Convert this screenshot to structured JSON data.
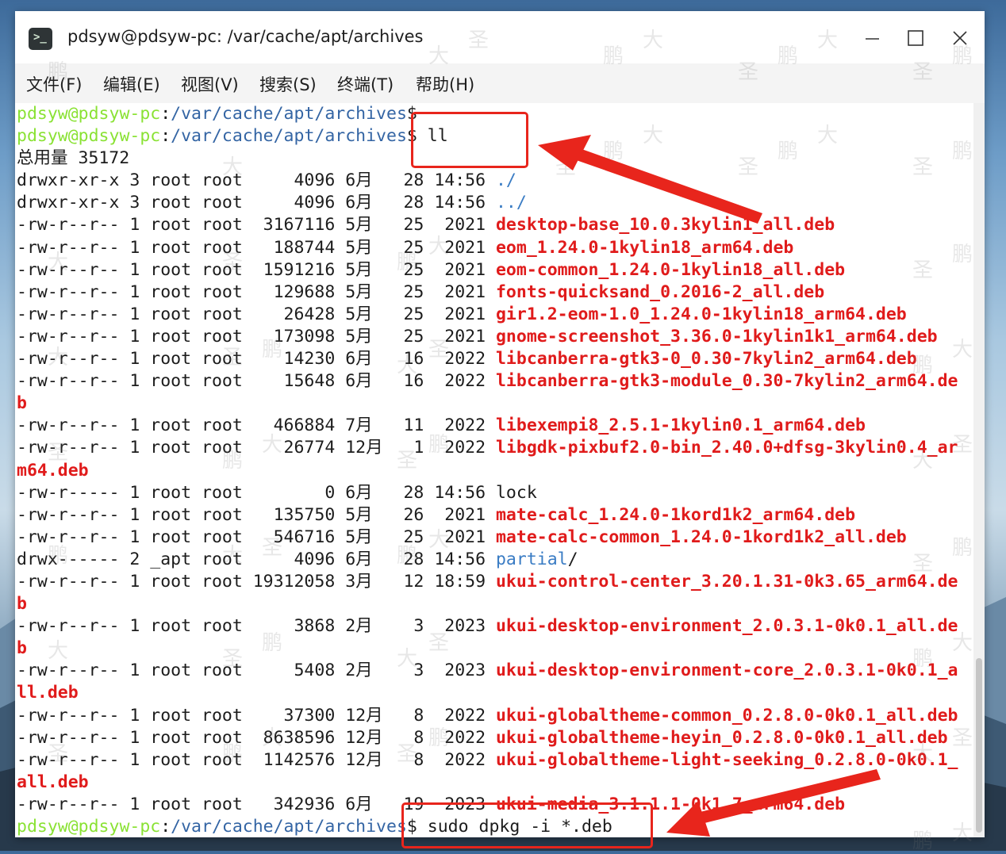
{
  "window": {
    "title": "pdsyw@pdsyw-pc: /var/cache/apt/archives",
    "icon": "terminal-icon"
  },
  "menu": [
    "文件(F)",
    "编辑(E)",
    "视图(V)",
    "搜索(S)",
    "终端(T)",
    "帮助(H)"
  ],
  "colors": {
    "prompt_user": "#8ae234",
    "prompt_path": "#3465a4",
    "deb_file": "#e01b1b",
    "directory": "#3a7cc4",
    "annotation": "#e8251c"
  },
  "terminal": {
    "prompt_user": "pdsyw@pdsyw-pc",
    "prompt_sep": ":",
    "prompt_path": "/var/cache/apt/archives",
    "prompt_end": "$",
    "command_1": "ll",
    "total_line": "总用量 35172",
    "entries": [
      {
        "meta": "drwxr-xr-x 3 root root     4096 6月   28 14:56 ",
        "name": "./",
        "kind": "dir"
      },
      {
        "meta": "drwxr-xr-x 3 root root     4096 6月   28 14:56 ",
        "name": "../",
        "kind": "dir"
      },
      {
        "meta": "-rw-r--r-- 1 root root  3167116 5月   25  2021 ",
        "name": "desktop-base_10.0.3kylin1_all.deb",
        "kind": "deb"
      },
      {
        "meta": "-rw-r--r-- 1 root root   188744 5月   25  2021 ",
        "name": "eom_1.24.0-1kylin18_arm64.deb",
        "kind": "deb"
      },
      {
        "meta": "-rw-r--r-- 1 root root  1591216 5月   25  2021 ",
        "name": "eom-common_1.24.0-1kylin18_all.deb",
        "kind": "deb"
      },
      {
        "meta": "-rw-r--r-- 1 root root   129688 5月   25  2021 ",
        "name": "fonts-quicksand_0.2016-2_all.deb",
        "kind": "deb"
      },
      {
        "meta": "-rw-r--r-- 1 root root    26428 5月   25  2021 ",
        "name": "gir1.2-eom-1.0_1.24.0-1kylin18_arm64.deb",
        "kind": "deb"
      },
      {
        "meta": "-rw-r--r-- 1 root root   173098 5月   25  2021 ",
        "name": "gnome-screenshot_3.36.0-1kylin1k1_arm64.deb",
        "kind": "deb"
      },
      {
        "meta": "-rw-r--r-- 1 root root    14230 6月   16  2022 ",
        "name": "libcanberra-gtk3-0_0.30-7kylin2_arm64.deb",
        "kind": "deb"
      },
      {
        "meta": "-rw-r--r-- 1 root root    15648 6月   16  2022 ",
        "name": "libcanberra-gtk3-module_0.30-7kylin2_arm64.de",
        "wrap": "b",
        "kind": "deb"
      },
      {
        "meta": "-rw-r--r-- 1 root root   466884 7月   11  2022 ",
        "name": "libexempi8_2.5.1-1kylin0.1_arm64.deb",
        "kind": "deb"
      },
      {
        "meta": "-rw-r--r-- 1 root root    26774 12月   1  2022 ",
        "name": "libgdk-pixbuf2.0-bin_2.40.0+dfsg-3kylin0.4_ar",
        "wrap": "m64.deb",
        "kind": "deb"
      },
      {
        "meta": "-rw-r----- 1 root root        0 6月   28 14:56 ",
        "name": "lock",
        "kind": "plain"
      },
      {
        "meta": "-rw-r--r-- 1 root root   135750 5月   26  2021 ",
        "name": "mate-calc_1.24.0-1kord1k2_arm64.deb",
        "kind": "deb"
      },
      {
        "meta": "-rw-r--r-- 1 root root   546716 5月   25  2021 ",
        "name": "mate-calc-common_1.24.0-1kord1k2_all.deb",
        "kind": "deb"
      },
      {
        "meta": "drwx------ 2 _apt root     4096 6月   28 14:56 ",
        "name": "partial",
        "suffix": "/",
        "kind": "dir"
      },
      {
        "meta": "-rw-r--r-- 1 root root 19312058 3月   12 18:59 ",
        "name": "ukui-control-center_3.20.1.31-0k3.65_arm64.de",
        "wrap": "b",
        "kind": "deb"
      },
      {
        "meta": "-rw-r--r-- 1 root root     3868 2月    3  2023 ",
        "name": "ukui-desktop-environment_2.0.3.1-0k0.1_all.de",
        "wrap": "b",
        "kind": "deb"
      },
      {
        "meta": "-rw-r--r-- 1 root root     5408 2月    3  2023 ",
        "name": "ukui-desktop-environment-core_2.0.3.1-0k0.1_a",
        "wrap": "ll.deb",
        "kind": "deb"
      },
      {
        "meta": "-rw-r--r-- 1 root root    37300 12月   8  2022 ",
        "name": "ukui-globaltheme-common_0.2.8.0-0k0.1_all.deb",
        "kind": "deb"
      },
      {
        "meta": "-rw-r--r-- 1 root root  8638596 12月   8  2022 ",
        "name": "ukui-globaltheme-heyin_0.2.8.0-0k0.1_all.deb",
        "kind": "deb"
      },
      {
        "meta": "-rw-r--r-- 1 root root  1142576 12月   8  2022 ",
        "name": "ukui-globaltheme-light-seeking_0.2.8.0-0k0.1_",
        "wrap": "all.deb",
        "kind": "deb"
      },
      {
        "meta": "-rw-r--r-- 1 root root   342936 6月   19  2023 ",
        "name": "ukui-media_3.1.1.1-0k1.7_arm64.deb",
        "kind": "deb"
      }
    ],
    "command_2": "sudo dpkg -i *.deb"
  },
  "watermark_chars": [
    "鹏",
    "大",
    "圣"
  ]
}
